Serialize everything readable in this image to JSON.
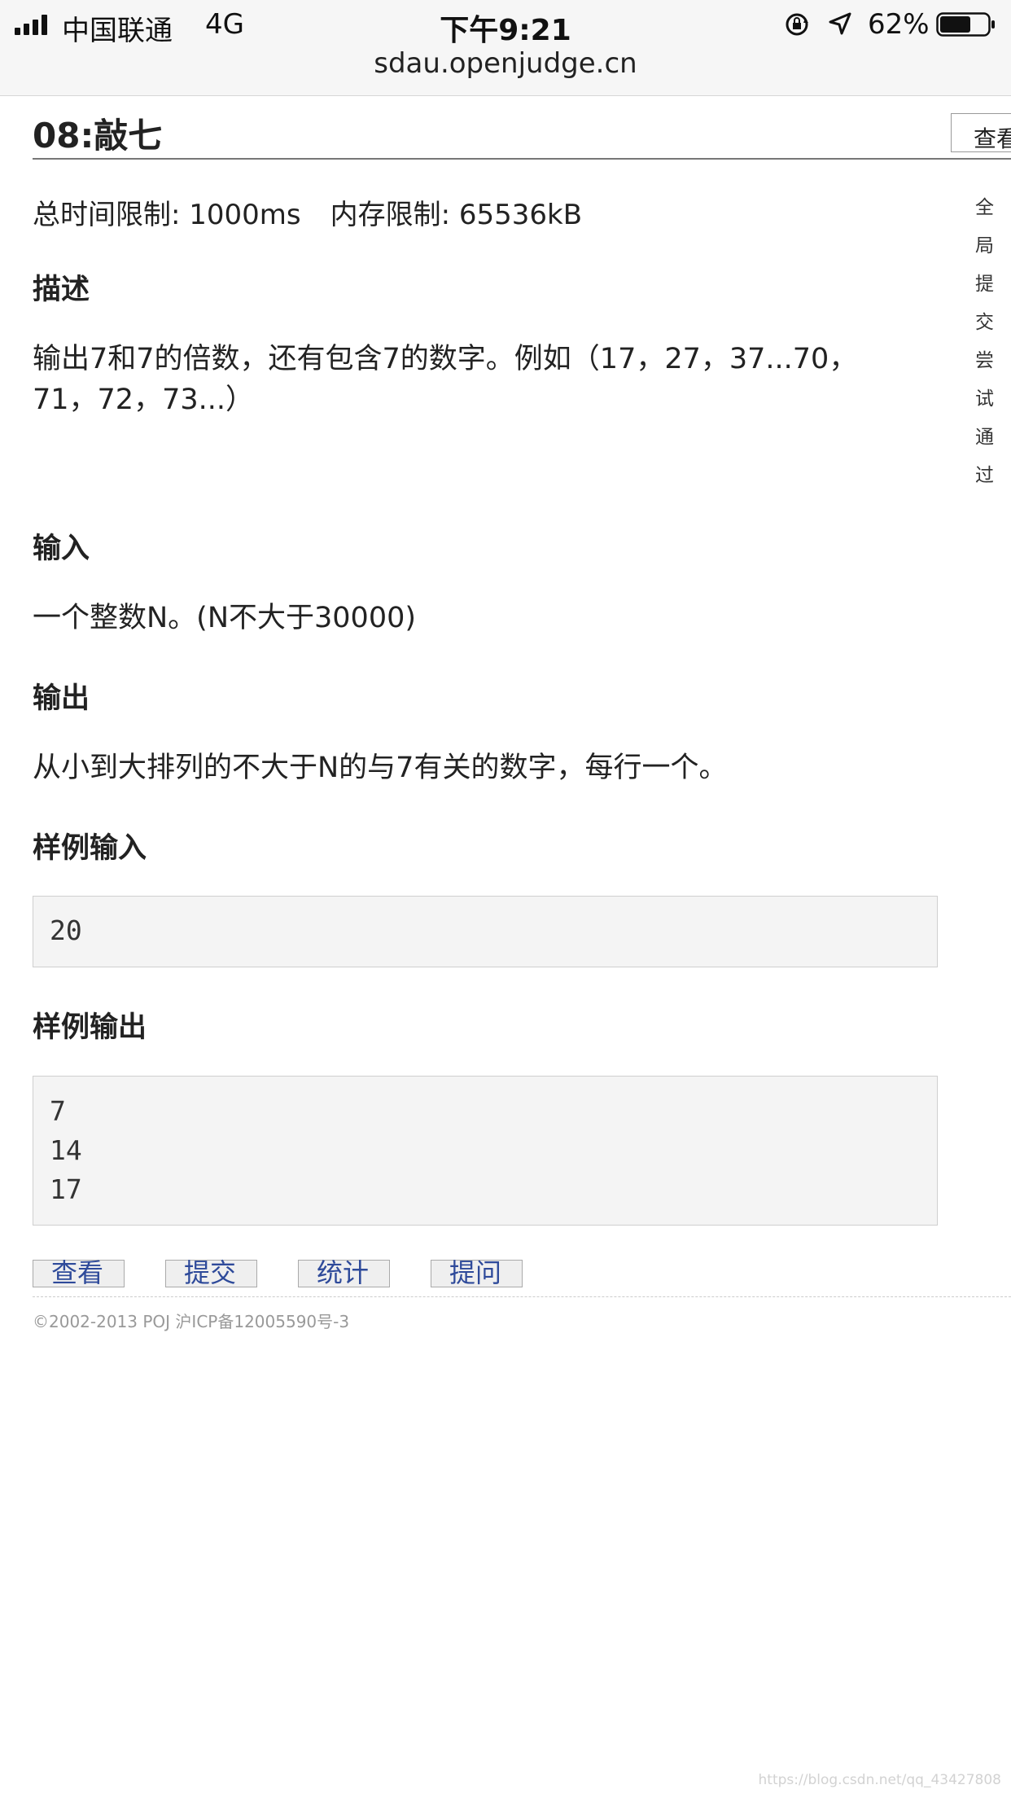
{
  "status_bar": {
    "carrier": "中国联通",
    "network": "4G",
    "time": "下午9:21",
    "battery": "62%"
  },
  "browser": {
    "url": "sdau.openjudge.cn"
  },
  "problem": {
    "title": "08:敲七",
    "view_tab": "查看",
    "stats_labels": [
      "全局",
      "提交",
      "尝试",
      "通过"
    ],
    "time_limit": "总时间限制: 1000ms",
    "memory_limit": "内存限制: 65536kB",
    "description_title": "描述",
    "description_line1": "输出7和7的倍数，还有包含7的数字。例如（17，27，37...70，",
    "description_line2": "71，72，73...）",
    "input_title": "输入",
    "input_text": "一个整数N。(N不大于30000)",
    "output_title": "输出",
    "output_text": "从小到大排列的不大于N的与7有关的数字，每行一个。",
    "sample_input_title": "样例输入",
    "sample_input": "20",
    "sample_output_title": "样例输出",
    "sample_output": "7\n14\n17"
  },
  "actions": {
    "view": "查看",
    "submit": "提交",
    "statistics": "统计",
    "ask": "提问"
  },
  "footer": {
    "copyright": "©2002-2013 POJ 沪ICP备12005590号-3",
    "watermark": "https://blog.csdn.net/qq_43427808"
  }
}
